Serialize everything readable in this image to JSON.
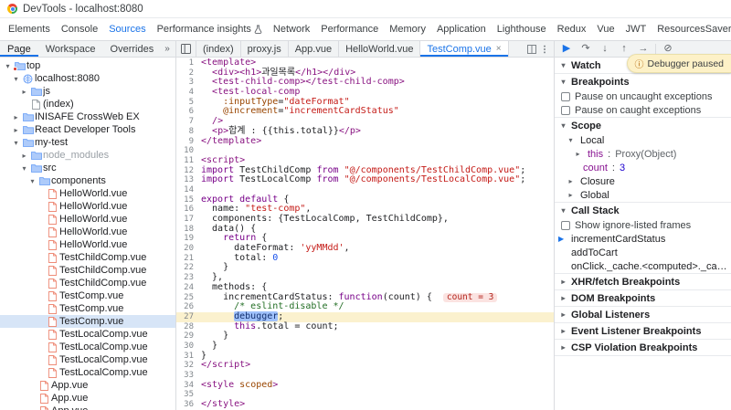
{
  "window": {
    "title": "DevTools - localhost:8080"
  },
  "icons": {
    "expanded": "▾",
    "collapsed": "▸",
    "more": "»"
  },
  "main_tabs": {
    "active": "Sources",
    "items": [
      {
        "label": "Elements"
      },
      {
        "label": "Console"
      },
      {
        "label": "Sources"
      },
      {
        "label": "Performance insights",
        "icon": "flask"
      },
      {
        "label": "Network"
      },
      {
        "label": "Performance"
      },
      {
        "label": "Memory"
      },
      {
        "label": "Application"
      },
      {
        "label": "Lighthouse"
      },
      {
        "label": "Redux"
      },
      {
        "label": "Vue"
      },
      {
        "label": "JWT"
      },
      {
        "label": "ResourcesSaver"
      }
    ]
  },
  "navigator": {
    "tabs": [
      "Page",
      "Workspace",
      "Overrides"
    ],
    "active": "Page",
    "more_icon": "»",
    "tree": [
      {
        "label": "top",
        "depth": 0,
        "kind": "folder",
        "state": "open",
        "badge": true
      },
      {
        "label": "localhost:8080",
        "depth": 1,
        "kind": "globe",
        "state": "open"
      },
      {
        "label": "js",
        "depth": 2,
        "kind": "folder",
        "state": "closed"
      },
      {
        "label": "(index)",
        "depth": 2,
        "kind": "doc",
        "state": "none"
      },
      {
        "label": "INISAFE CrossWeb EX",
        "depth": 1,
        "kind": "folder",
        "state": "closed"
      },
      {
        "label": "React Developer Tools",
        "depth": 1,
        "kind": "folder",
        "state": "closed"
      },
      {
        "label": "my-test",
        "depth": 1,
        "kind": "folder",
        "state": "open"
      },
      {
        "label": "node_modules",
        "depth": 2,
        "kind": "folder",
        "state": "closed",
        "dim": true
      },
      {
        "label": "src",
        "depth": 2,
        "kind": "folder",
        "state": "open"
      },
      {
        "label": "components",
        "depth": 3,
        "kind": "folder",
        "state": "open"
      },
      {
        "label": "HelloWorld.vue",
        "depth": 4,
        "kind": "vue",
        "state": "none"
      },
      {
        "label": "HelloWorld.vue",
        "depth": 4,
        "kind": "vue",
        "state": "none"
      },
      {
        "label": "HelloWorld.vue",
        "depth": 4,
        "kind": "vue",
        "state": "none"
      },
      {
        "label": "HelloWorld.vue",
        "depth": 4,
        "kind": "vue",
        "state": "none"
      },
      {
        "label": "HelloWorld.vue",
        "depth": 4,
        "kind": "vue",
        "state": "none"
      },
      {
        "label": "TestChildComp.vue",
        "depth": 4,
        "kind": "vue",
        "state": "none"
      },
      {
        "label": "TestChildComp.vue",
        "depth": 4,
        "kind": "vue",
        "state": "none"
      },
      {
        "label": "TestChildComp.vue",
        "depth": 4,
        "kind": "vue",
        "state": "none"
      },
      {
        "label": "TestComp.vue",
        "depth": 4,
        "kind": "vue",
        "state": "none"
      },
      {
        "label": "TestComp.vue",
        "depth": 4,
        "kind": "vue",
        "state": "none"
      },
      {
        "label": "TestComp.vue",
        "depth": 4,
        "kind": "vue",
        "state": "none",
        "selected": true
      },
      {
        "label": "TestLocalComp.vue",
        "depth": 4,
        "kind": "vue",
        "state": "none"
      },
      {
        "label": "TestLocalComp.vue",
        "depth": 4,
        "kind": "vue",
        "state": "none"
      },
      {
        "label": "TestLocalComp.vue",
        "depth": 4,
        "kind": "vue",
        "state": "none"
      },
      {
        "label": "TestLocalComp.vue",
        "depth": 4,
        "kind": "vue",
        "state": "none"
      },
      {
        "label": "App.vue",
        "depth": 3,
        "kind": "vue",
        "state": "none"
      },
      {
        "label": "App.vue",
        "depth": 3,
        "kind": "vue",
        "state": "none"
      },
      {
        "label": "App.vue",
        "depth": 3,
        "kind": "vue",
        "state": "none"
      }
    ]
  },
  "editor": {
    "file_tabs": [
      "(index)",
      "proxy.js",
      "App.vue",
      "HelloWorld.vue",
      "TestComp.vue"
    ],
    "active_tab": "TestComp.vue",
    "close_glyph": "×",
    "inline_hint": "count = 3",
    "paused_line": 27,
    "lines": [
      {
        "t": [
          [
            "t",
            "<template>"
          ]
        ]
      },
      {
        "t": [
          [
            "p",
            "  "
          ],
          [
            "t",
            "<div><h1>"
          ],
          [
            "p",
            "과일목록"
          ],
          [
            "t",
            "</h1></div>"
          ]
        ]
      },
      {
        "t": [
          [
            "p",
            "  "
          ],
          [
            "t",
            "<test-child-comp></test-child-comp>"
          ]
        ]
      },
      {
        "t": [
          [
            "p",
            "  "
          ],
          [
            "t",
            "<test-local-comp"
          ]
        ]
      },
      {
        "t": [
          [
            "p",
            "    "
          ],
          [
            "a",
            ":inputType"
          ],
          [
            "p",
            "="
          ],
          [
            "s",
            "\"dateFormat\""
          ]
        ]
      },
      {
        "t": [
          [
            "p",
            "    "
          ],
          [
            "a",
            "@increment"
          ],
          [
            "p",
            "="
          ],
          [
            "s",
            "\"incrementCardStatus\""
          ]
        ]
      },
      {
        "t": [
          [
            "p",
            "  "
          ],
          [
            "t",
            "/>"
          ]
        ]
      },
      {
        "t": [
          [
            "p",
            "  "
          ],
          [
            "t",
            "<p>"
          ],
          [
            "p",
            "합계 : {{this.total}}"
          ],
          [
            "t",
            "</p>"
          ]
        ]
      },
      {
        "t": [
          [
            "t",
            "</template>"
          ]
        ]
      },
      {
        "t": []
      },
      {
        "t": [
          [
            "t",
            "<script>"
          ]
        ]
      },
      {
        "t": [
          [
            "k",
            "import"
          ],
          [
            "p",
            " TestChildComp "
          ],
          [
            "k",
            "from"
          ],
          [
            "p",
            " "
          ],
          [
            "s",
            "\"@/components/TestChildComp.vue\""
          ],
          [
            "p",
            ";"
          ]
        ]
      },
      {
        "t": [
          [
            "k",
            "import"
          ],
          [
            "p",
            " TestLocalComp "
          ],
          [
            "k",
            "from"
          ],
          [
            "p",
            " "
          ],
          [
            "s",
            "\"@/components/TestLocalComp.vue\""
          ],
          [
            "p",
            ";"
          ]
        ]
      },
      {
        "t": []
      },
      {
        "t": [
          [
            "k",
            "export"
          ],
          [
            "p",
            " "
          ],
          [
            "k",
            "default"
          ],
          [
            "p",
            " {"
          ]
        ]
      },
      {
        "t": [
          [
            "p",
            "  name: "
          ],
          [
            "s",
            "\"test-comp\""
          ],
          [
            "p",
            ","
          ]
        ]
      },
      {
        "t": [
          [
            "p",
            "  components: {TestLocalComp, TestChildComp},"
          ]
        ]
      },
      {
        "t": [
          [
            "p",
            "  data() {"
          ]
        ]
      },
      {
        "t": [
          [
            "p",
            "    "
          ],
          [
            "k",
            "return"
          ],
          [
            "p",
            " {"
          ]
        ]
      },
      {
        "t": [
          [
            "p",
            "      dateFormat: "
          ],
          [
            "s",
            "'yyMMdd'"
          ],
          [
            "p",
            ","
          ]
        ]
      },
      {
        "t": [
          [
            "p",
            "      total: "
          ],
          [
            "n",
            "0"
          ]
        ]
      },
      {
        "t": [
          [
            "p",
            "    }"
          ]
        ]
      },
      {
        "t": [
          [
            "p",
            "  },"
          ]
        ]
      },
      {
        "t": [
          [
            "p",
            "  methods: {"
          ]
        ]
      },
      {
        "t": [
          [
            "p",
            "    incrementCardStatus: "
          ],
          [
            "k",
            "function"
          ],
          [
            "p",
            "(count) {"
          ]
        ],
        "w": true
      },
      {
        "t": [
          [
            "p",
            "      "
          ],
          [
            "c",
            "/* eslint-disable */"
          ]
        ]
      },
      {
        "t": [
          [
            "p",
            "      "
          ],
          [
            "d",
            "debugger"
          ],
          [
            "p",
            ";"
          ]
        ],
        "cur": true
      },
      {
        "t": [
          [
            "p",
            "      "
          ],
          [
            "k",
            "this"
          ],
          [
            "p",
            ".total = count;"
          ]
        ]
      },
      {
        "t": [
          [
            "p",
            "    }"
          ]
        ]
      },
      {
        "t": [
          [
            "p",
            "  }"
          ]
        ]
      },
      {
        "t": [
          [
            "p",
            "}"
          ]
        ]
      },
      {
        "t": [
          [
            "t",
            "</script>"
          ]
        ]
      },
      {
        "t": []
      },
      {
        "t": [
          [
            "t",
            "<style "
          ],
          [
            "a",
            "scoped"
          ],
          [
            "t",
            ">"
          ]
        ]
      },
      {
        "t": []
      },
      {
        "t": [
          [
            "t",
            "</style>"
          ]
        ]
      }
    ]
  },
  "debugger": {
    "controls": [
      {
        "name": "resume",
        "glyph": "▶"
      },
      {
        "name": "step-over",
        "glyph": "↷"
      },
      {
        "name": "step-into",
        "glyph": "↓"
      },
      {
        "name": "step-out",
        "glyph": "↑"
      },
      {
        "name": "step",
        "glyph": "→"
      },
      {
        "name": "deactivate-breakpoints",
        "glyph": "⊘"
      }
    ],
    "paused_badge": {
      "icon": "ⓘ",
      "label": "Debugger paused"
    },
    "sections": {
      "watch": {
        "label": "Watch",
        "icons": [
          "+",
          "⟳"
        ]
      },
      "breakpoints": {
        "label": "Breakpoints",
        "options": [
          {
            "label": "Pause on uncaught exceptions",
            "checked": false
          },
          {
            "label": "Pause on caught exceptions",
            "checked": false
          }
        ]
      },
      "scope": {
        "label": "Scope",
        "groups": [
          {
            "label": "Local",
            "expanded": true,
            "vars": [
              {
                "name": "this",
                "value": "Proxy(Object)",
                "expandable": true,
                "type": "object"
              },
              {
                "name": "count",
                "value": "3",
                "expandable": false,
                "type": "number"
              }
            ]
          },
          {
            "label": "Closure",
            "expanded": false,
            "vars": []
          },
          {
            "label": "Global",
            "expanded": false,
            "vars": []
          }
        ]
      },
      "call_stack": {
        "label": "Call Stack",
        "checkbox": "Show ignore-listed frames",
        "frames": [
          {
            "name": "incrementCardStatus",
            "current": true
          },
          {
            "name": "addToCart",
            "current": false
          },
          {
            "name": "onClick._cache.<computed>._cache.<computed>",
            "current": false
          }
        ]
      },
      "collapsed": [
        "XHR/fetch Breakpoints",
        "DOM Breakpoints",
        "Global Listeners",
        "Event Listener Breakpoints",
        "CSP Violation Breakpoints"
      ]
    }
  }
}
